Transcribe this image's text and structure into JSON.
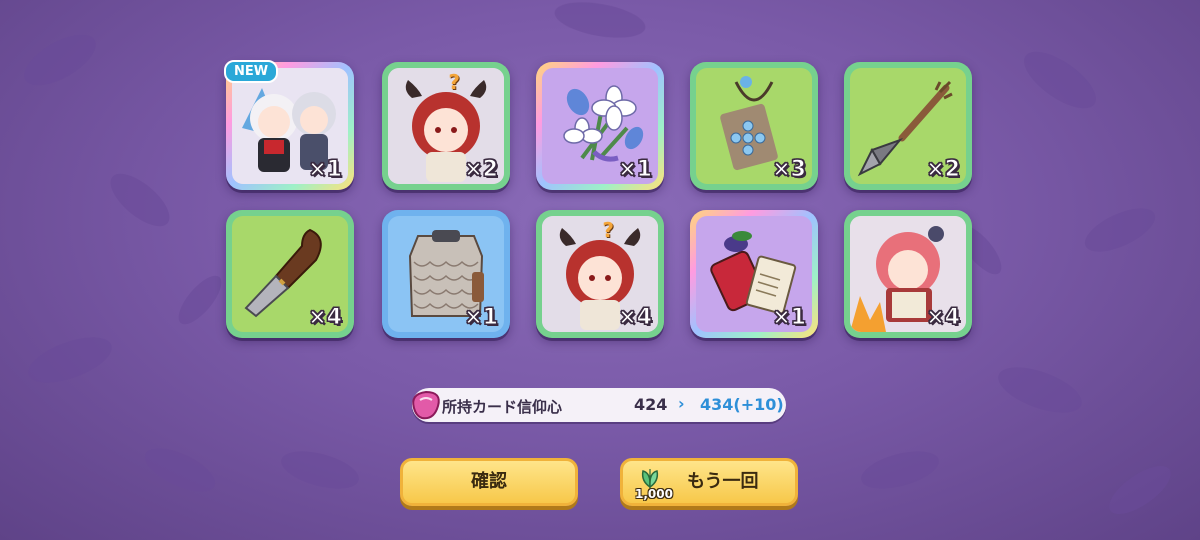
{
  "rewards": [
    {
      "name": "character-card",
      "quantity": "×1",
      "new_badge": "NEW",
      "frame": "rainbow"
    },
    {
      "name": "character-card",
      "quantity": "×2",
      "unknown_mark": "?",
      "frame": "green"
    },
    {
      "name": "flower-bouquet",
      "quantity": "×1",
      "frame": "rainbow"
    },
    {
      "name": "wooden-charm",
      "quantity": "×3",
      "frame": "green"
    },
    {
      "name": "spear-tip",
      "quantity": "×2",
      "frame": "green"
    },
    {
      "name": "chisel",
      "quantity": "×4",
      "frame": "green"
    },
    {
      "name": "scale-armor",
      "quantity": "×1",
      "frame": "blue"
    },
    {
      "name": "character-card",
      "quantity": "×4",
      "unknown_mark": "?",
      "frame": "green"
    },
    {
      "name": "magic-book-item",
      "quantity": "×1",
      "frame": "rainbow"
    },
    {
      "name": "character-card",
      "quantity": "×4",
      "frame": "green"
    }
  ],
  "faith": {
    "label": "所持カード信仰心",
    "current": "424",
    "arrow": "›",
    "new_value": "434(+10)"
  },
  "buttons": {
    "confirm": "確認",
    "again": "もう一回",
    "again_cost": "1,000"
  },
  "colors": {
    "accent_blue": "#2e8fd8",
    "button_yellow": "#f7c84a",
    "bg_purple": "#7a5aa8"
  }
}
